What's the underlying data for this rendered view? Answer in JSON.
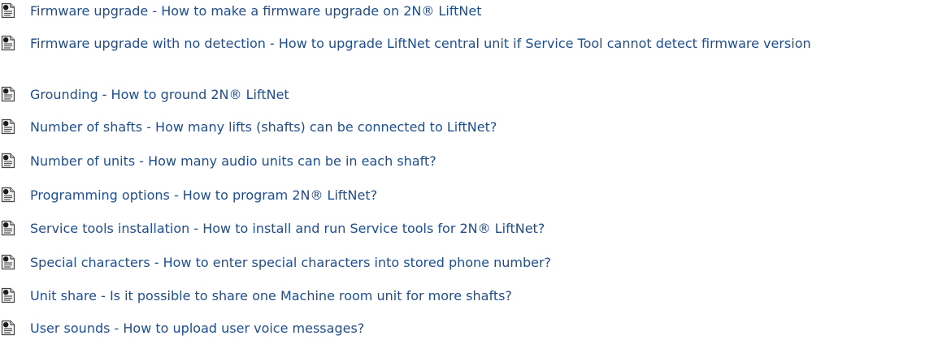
{
  "articles": [
    {
      "label": "Firmware upgrade - How to make a firmware upgrade on 2N® LiftNet",
      "icon": "document-icon"
    },
    {
      "label": "Firmware upgrade with no detection - How to upgrade LiftNet central unit if Service Tool cannot detect firmware version",
      "icon": "document-icon"
    },
    {
      "label": "Grounding - How to ground 2N® LiftNet",
      "icon": "document-icon"
    },
    {
      "label": "Number of shafts - How many lifts (shafts) can be connected to LiftNet?",
      "icon": "document-icon"
    },
    {
      "label": "Number of units - How many audio units can be in each shaft?",
      "icon": "document-icon"
    },
    {
      "label": "Programming options - How to program 2N® LiftNet?",
      "icon": "document-icon"
    },
    {
      "label": "Service tools installation - How to install and run Service tools for 2N® LiftNet?",
      "icon": "document-icon"
    },
    {
      "label": "Special characters - How to enter special characters into stored phone number?",
      "icon": "document-icon"
    },
    {
      "label": "Unit share - Is it possible to share one Machine room unit for more shafts?",
      "icon": "document-icon"
    },
    {
      "label": "User sounds - How to upload user voice messages?",
      "icon": "document-icon"
    }
  ],
  "colors": {
    "link": "#1f4e8c",
    "icon_fill": "#1a1a1a"
  }
}
